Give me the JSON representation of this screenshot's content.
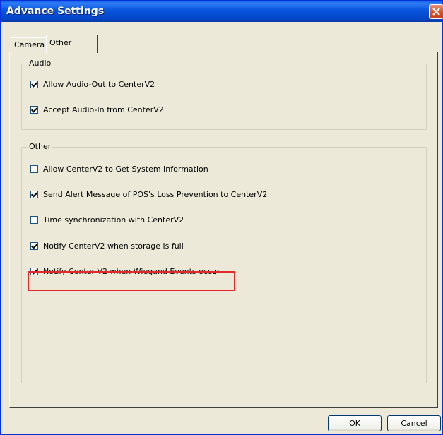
{
  "window": {
    "title": "Advance Settings"
  },
  "tabs": [
    {
      "label": "Camera",
      "selected": false
    },
    {
      "label": "Other",
      "selected": true
    }
  ],
  "audio_group": {
    "title": "Audio",
    "items": [
      {
        "label": "Allow Audio-Out to CenterV2",
        "checked": true
      },
      {
        "label": "Accept Audio-In from CenterV2",
        "checked": true
      }
    ]
  },
  "other_group": {
    "title": "Other",
    "items": [
      {
        "label": "Allow CenterV2 to Get System Information",
        "checked": false
      },
      {
        "label": "Send Alert Message of POS's Loss Prevention to CenterV2",
        "checked": true
      },
      {
        "label": "Time synchronization with CenterV2",
        "checked": false
      },
      {
        "label": "Notify CenterV2 when storage is full",
        "checked": true
      },
      {
        "label": "Notify Center V2 when Wiegand Events occur",
        "checked": true
      }
    ]
  },
  "buttons": {
    "ok": "OK",
    "cancel": "Cancel"
  },
  "colors": {
    "highlight": "#e32a2a",
    "titlebar": "#0855dd"
  }
}
